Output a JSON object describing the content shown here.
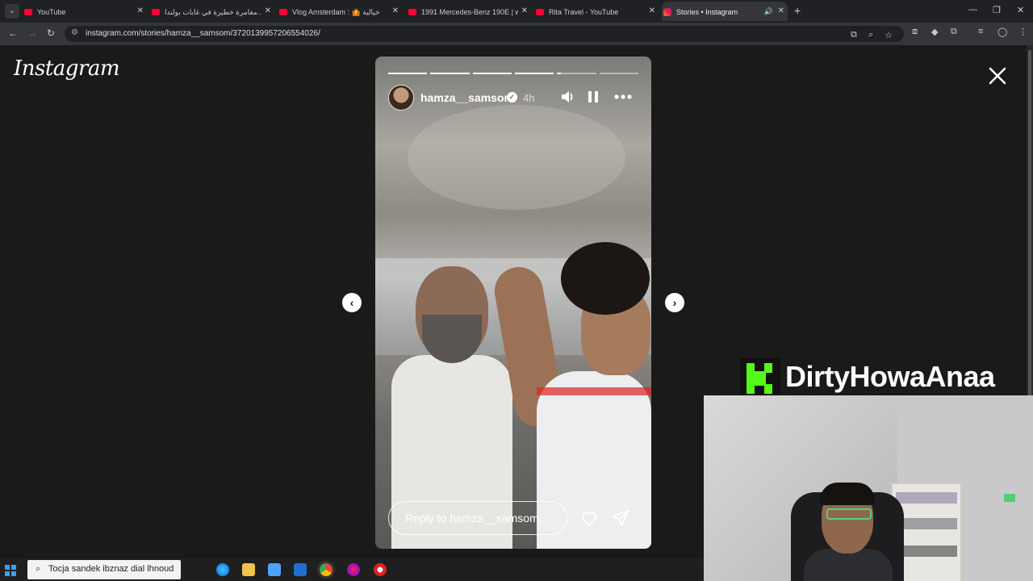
{
  "browser": {
    "tabs": [
      {
        "title": "YouTube",
        "favicon": "youtube-icon"
      },
      {
        "title": "مغامرة خطيرة في غابات بولندا...",
        "favicon": "youtube-icon"
      },
      {
        "title": "Vlog Amsterdam : 🤷 خيالية",
        "favicon": "youtube-icon"
      },
      {
        "title": "1991 Mercedes-Benz 190E | wa",
        "favicon": "youtube-icon"
      },
      {
        "title": "Rita Travel - YouTube",
        "favicon": "youtube-icon"
      },
      {
        "title": "Stories • Instagram",
        "favicon": "instagram-icon",
        "active": true
      }
    ],
    "url": "instagram.com/stories/hamza__samsom/3720139957206554026/"
  },
  "instagram": {
    "logo": "Instagram",
    "story": {
      "username": "hamza__samsom",
      "time_ago": "4h",
      "progress_segments": [
        1,
        1,
        1,
        1,
        0.1,
        0
      ],
      "reply_placeholder": "Reply to hamza__samsom..."
    }
  },
  "overlay": {
    "channel_name": "DirtyHowaAnaa",
    "accent": "#53fc18"
  },
  "taskbar": {
    "search_text": "Tocja sandek ibznaz dial lhnoud"
  }
}
